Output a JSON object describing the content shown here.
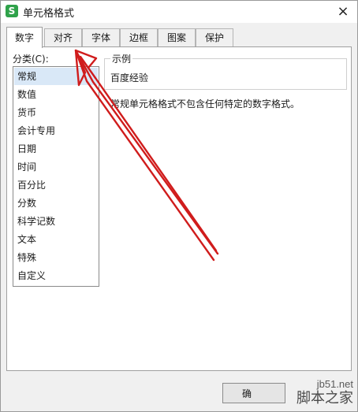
{
  "window": {
    "title": "单元格格式",
    "app_icon_letter": "S",
    "close_icon": "×",
    "colors": {
      "app_icon": "#2fa24a",
      "selection": "#d9e8f7",
      "arrow": "#d01c1c"
    }
  },
  "tabs": [
    {
      "label": "数字",
      "active": true
    },
    {
      "label": "对齐",
      "active": false
    },
    {
      "label": "字体",
      "active": false
    },
    {
      "label": "边框",
      "active": false
    },
    {
      "label": "图案",
      "active": false
    },
    {
      "label": "保护",
      "active": false
    }
  ],
  "category": {
    "label": "分类(C):",
    "items": [
      "常规",
      "数值",
      "货币",
      "会计专用",
      "日期",
      "时间",
      "百分比",
      "分数",
      "科学记数",
      "文本",
      "特殊",
      "自定义"
    ],
    "selected": "常规"
  },
  "sample": {
    "legend": "示例",
    "value": "百度经验"
  },
  "description": "常规单元格格式不包含任何特定的数字格式。",
  "ok_button": "确",
  "watermark": {
    "line1": "jb51.net",
    "line2": "脚本之家"
  }
}
